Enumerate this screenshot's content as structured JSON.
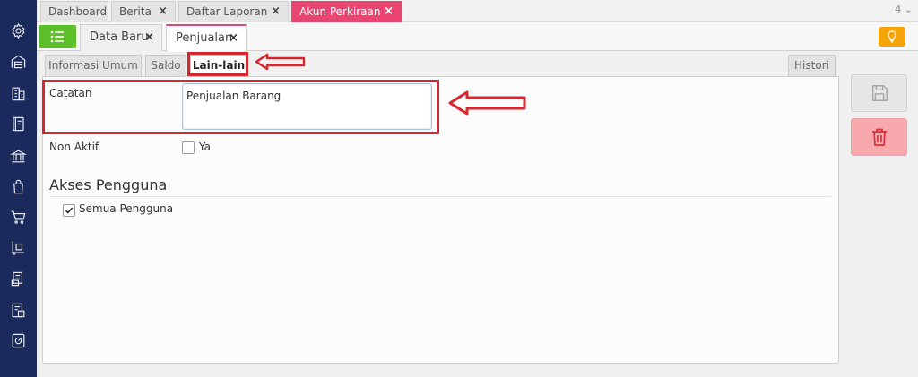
{
  "top_tabs": [
    {
      "label": "Dashboard",
      "closable": false
    },
    {
      "label": "Berita",
      "closable": true
    },
    {
      "label": "Daftar Laporan",
      "closable": true
    },
    {
      "label": "Akun Perkiraan",
      "closable": true,
      "active": true
    }
  ],
  "tab_count": "4",
  "secondary_tabs": [
    {
      "label": "Data Baru",
      "closable": true
    },
    {
      "label": "Penjualan",
      "closable": true,
      "active": true
    }
  ],
  "form_tabs": [
    {
      "label": "Informasi Umum"
    },
    {
      "label": "Saldo"
    },
    {
      "label": "Lain-lain",
      "active": true
    },
    {
      "label": "Histori"
    }
  ],
  "form": {
    "catatan_label": "Catatan",
    "catatan_value": "Penjualan Barang",
    "nonaktif_label": "Non Aktif",
    "nonaktif_option": "Ya",
    "nonaktif_checked": false
  },
  "akses": {
    "title": "Akses Pengguna",
    "semua_label": "Semua Pengguna",
    "semua_checked": true
  },
  "sidebar_icons": [
    "gear-icon",
    "warehouse-icon",
    "building-icon",
    "book-icon",
    "bank-icon",
    "shopping-bag-icon",
    "cart-icon",
    "hand-truck-icon",
    "report-icon",
    "tax-icon",
    "dashboard-icon"
  ],
  "colors": {
    "sidebar": "#1b2a5c",
    "active_tab": "#ea4470",
    "menu_button": "#5cbf2a",
    "bulb_button": "#f5a50a",
    "delete_button": "#f7a9ae",
    "annotation": "#d8262e"
  }
}
